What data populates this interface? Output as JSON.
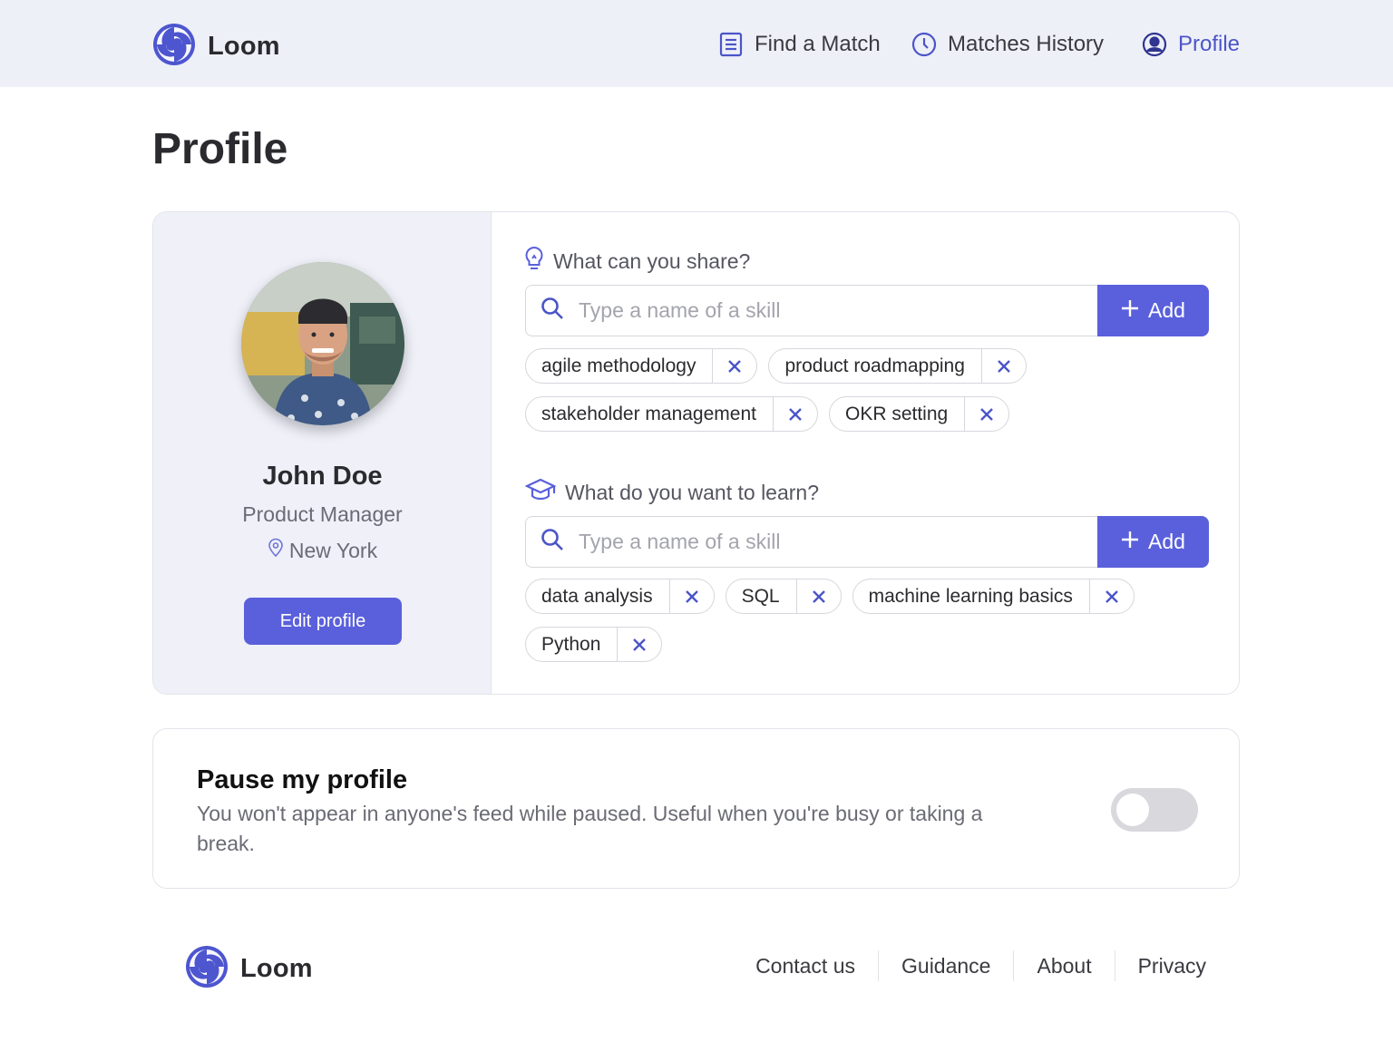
{
  "app": {
    "name": "Loom",
    "accent_color": "#5a60db",
    "active_nav_color": "#4b55c8"
  },
  "nav": {
    "items": [
      {
        "label": "Find a Match",
        "icon": "document-list-icon"
      },
      {
        "label": "Matches History",
        "icon": "clock-icon"
      },
      {
        "label": "Profile",
        "icon": "user-circle-icon",
        "active": true
      }
    ]
  },
  "page": {
    "title": "Profile"
  },
  "profile": {
    "name": "John Doe",
    "role": "Product Manager",
    "location": "New York",
    "edit_label": "Edit profile"
  },
  "share": {
    "heading": "What can you share?",
    "icon": "lightbulb-icon",
    "placeholder": "Type a name of a skill",
    "add_label": "Add",
    "skills": [
      "agile methodology",
      "product roadmapping",
      "stakeholder management",
      "OKR setting"
    ]
  },
  "learn": {
    "heading": "What do you want to learn?",
    "icon": "graduation-cap-icon",
    "placeholder": "Type a name of a skill",
    "add_label": "Add",
    "skills": [
      "data analysis",
      "SQL",
      "machine learning basics",
      "Python"
    ]
  },
  "pause": {
    "title": "Pause my profile",
    "description": "You won't appear in anyone's feed while paused. Useful when you're busy or taking a break.",
    "enabled": false
  },
  "footer": {
    "links": [
      "Contact us",
      "Guidance",
      "About",
      "Privacy"
    ]
  }
}
